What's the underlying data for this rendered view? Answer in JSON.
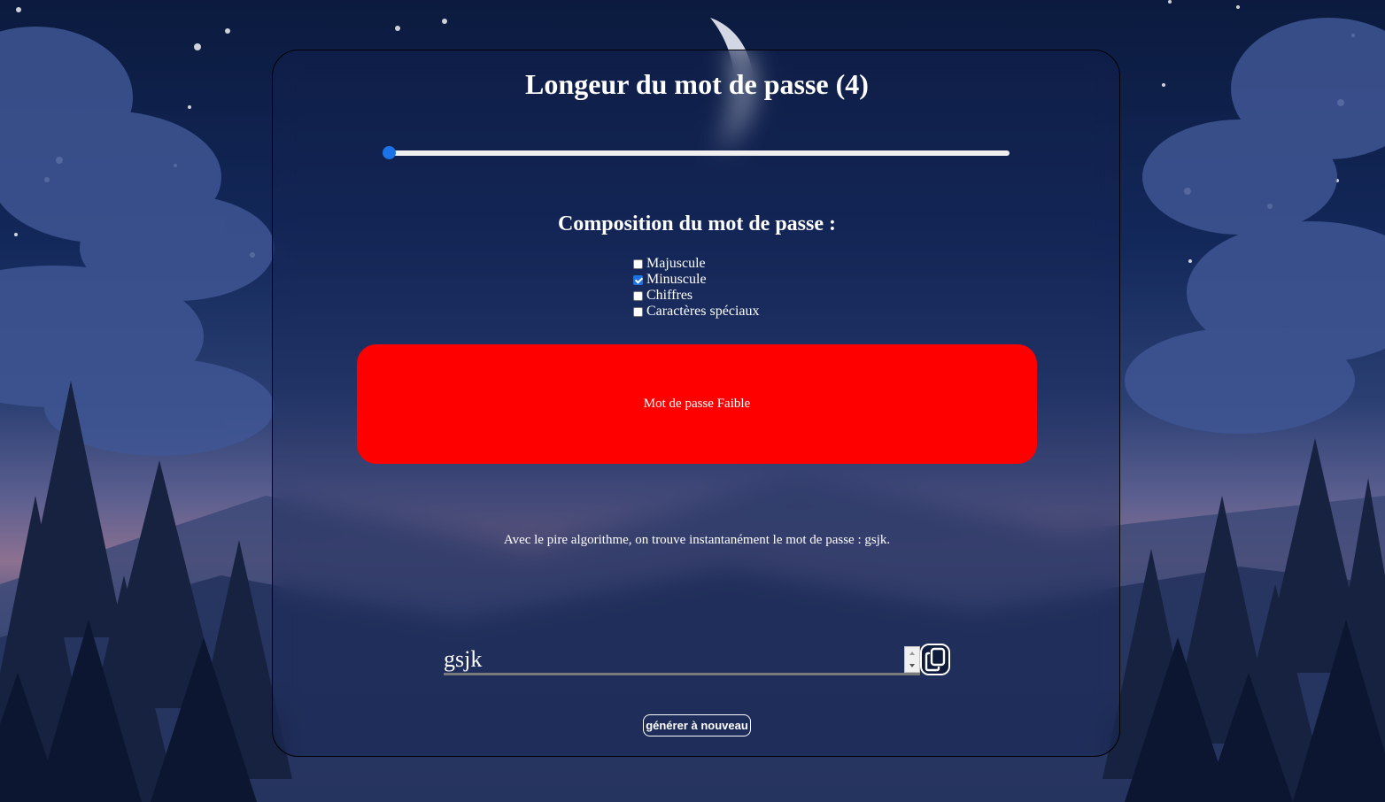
{
  "length": {
    "title": "Longeur du mot de passe (4)",
    "value": 4,
    "min": 4,
    "max": 50
  },
  "composition": {
    "title": "Composition du mot de passe :",
    "options": [
      {
        "label": "Majuscule",
        "checked": false
      },
      {
        "label": "Minuscule",
        "checked": true
      },
      {
        "label": "Chiffres",
        "checked": false
      },
      {
        "label": "Caractères spéciaux",
        "checked": false
      }
    ]
  },
  "strength": {
    "label": "Mot de passe Faible",
    "color": "#ff0000"
  },
  "explanation": "Avec le pire algorithme, on trouve instantanément le mot de passe : gsjk.",
  "password": {
    "value": "gsjk"
  },
  "icons": {
    "copy": "copy-icon"
  },
  "buttons": {
    "regenerate": "générer à nouveau"
  }
}
